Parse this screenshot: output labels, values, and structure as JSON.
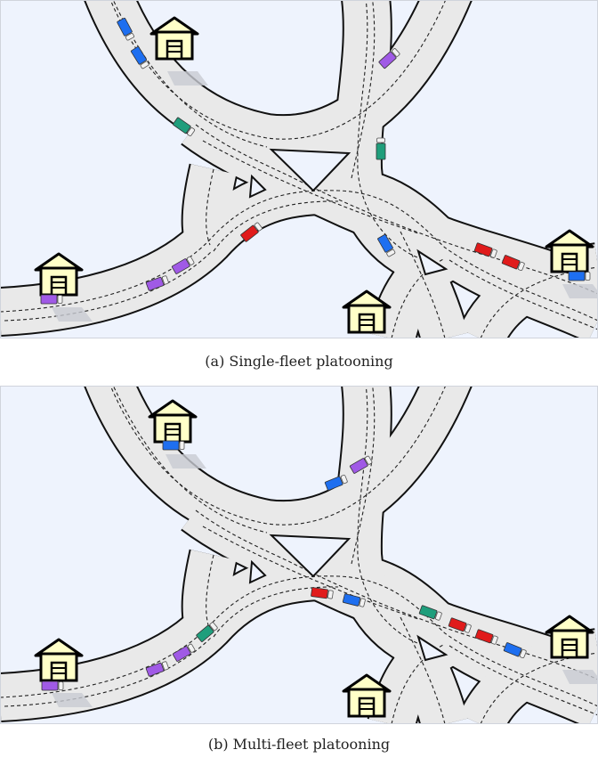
{
  "captions": {
    "a": "(a)  Single-fleet platooning",
    "b": "(b) Multi-fleet platooning"
  },
  "colors": {
    "background": "#eef3fd",
    "road": "#e9e9e9",
    "road_edge": "#111111",
    "lane_marking": "#222222",
    "house_fill": "#ffffc8",
    "fleets": {
      "blue": "#1e6ff0",
      "purple": "#a05ae6",
      "green": "#1f9e7c",
      "red": "#e01b1b"
    }
  },
  "icons": [
    "warehouse-icon",
    "truck-icon"
  ],
  "panel_a": {
    "trucks": [
      {
        "fleet": "blue"
      },
      {
        "fleet": "blue"
      },
      {
        "fleet": "purple"
      },
      {
        "fleet": "green"
      },
      {
        "fleet": "green"
      },
      {
        "fleet": "red"
      },
      {
        "fleet": "blue"
      },
      {
        "fleet": "red"
      },
      {
        "fleet": "red"
      },
      {
        "fleet": "blue"
      },
      {
        "fleet": "purple"
      },
      {
        "fleet": "purple"
      },
      {
        "fleet": "purple"
      }
    ]
  },
  "panel_b": {
    "trucks": [
      {
        "fleet": "blue"
      },
      {
        "fleet": "blue"
      },
      {
        "fleet": "purple"
      },
      {
        "fleet": "red"
      },
      {
        "fleet": "blue"
      },
      {
        "fleet": "green"
      },
      {
        "fleet": "red"
      },
      {
        "fleet": "red"
      },
      {
        "fleet": "blue"
      },
      {
        "fleet": "green"
      },
      {
        "fleet": "purple"
      },
      {
        "fleet": "purple"
      },
      {
        "fleet": "purple"
      }
    ]
  }
}
